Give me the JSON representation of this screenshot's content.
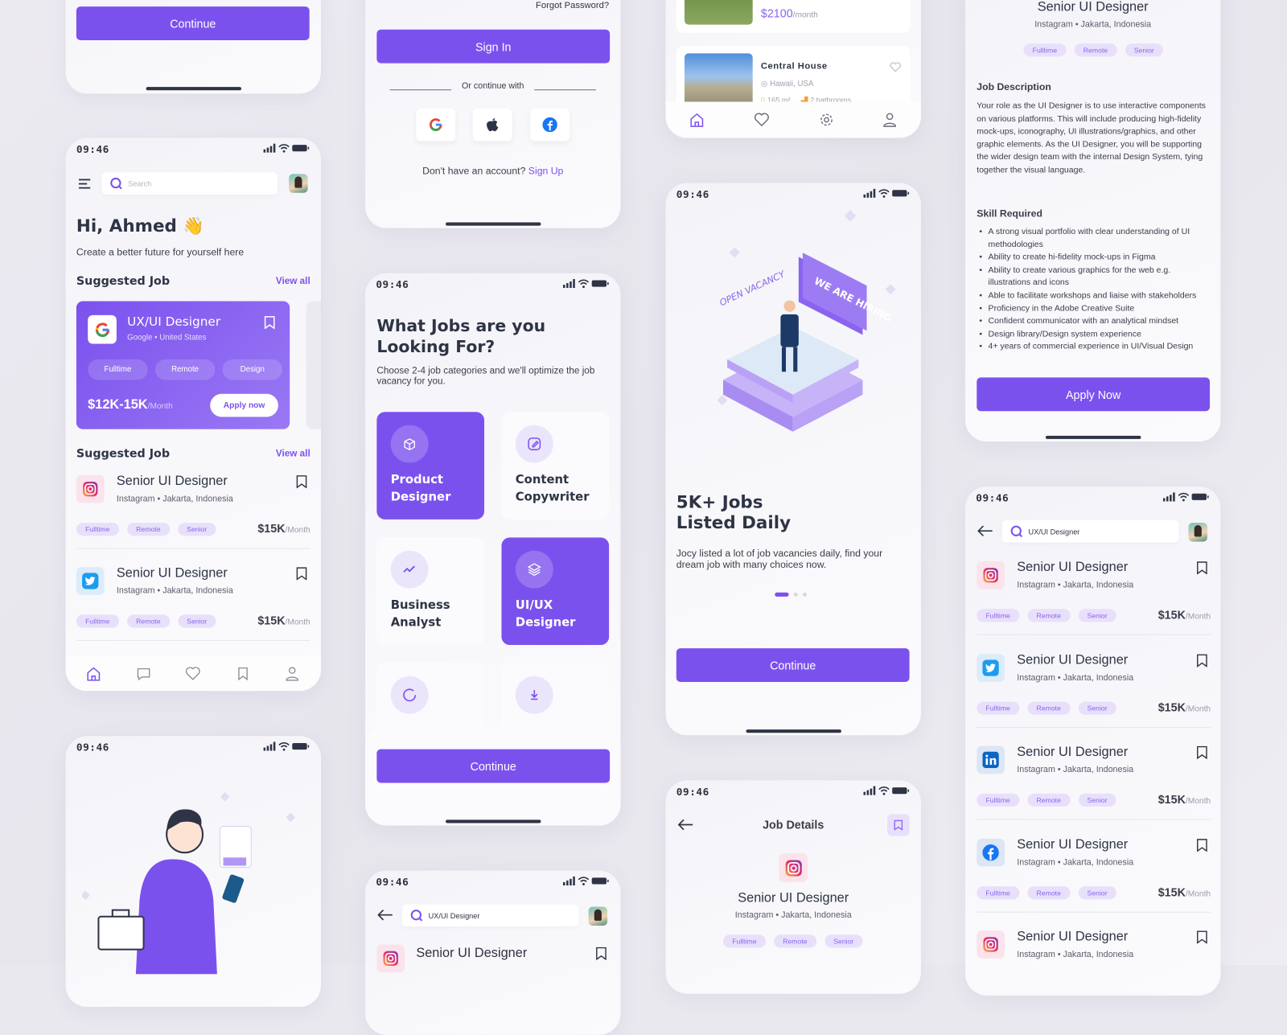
{
  "status": {
    "time": "09:46"
  },
  "onboard_top": {
    "continue_label": "Continue"
  },
  "home": {
    "search_placeholder": "Search",
    "greeting": "Hi, Ahmed",
    "greeting_emoji": "👋",
    "subtitle": "Create a better future for yourself here",
    "section1_title": "Suggested Job",
    "section2_title": "Suggested Job",
    "view_all": "View all",
    "featured": {
      "title": "UX/UI Designer",
      "company": "Google • United States",
      "tags": [
        "Fulltime",
        "Remote",
        "Design"
      ],
      "salary": "$12K-15K",
      "salary_unit": "/Month",
      "apply_label": "Apply now"
    },
    "jobs": [
      {
        "logo": "instagram",
        "title": "Senior UI Designer",
        "company": "Instagram • Jakarta, Indonesia",
        "tags": [
          "Fulltime",
          "Remote",
          "Senior"
        ],
        "salary": "$15K",
        "unit": "/Month"
      },
      {
        "logo": "twitter",
        "title": "Senior UI Designer",
        "company": "Instagram • Jakarta, Indonesia",
        "tags": [
          "Fulltime",
          "Remote",
          "Senior"
        ],
        "salary": "$15K",
        "unit": "/Month"
      }
    ],
    "nav": [
      "home-icon",
      "chat-icon",
      "heart-icon",
      "bookmark-icon",
      "user-icon"
    ]
  },
  "signin": {
    "forgot": "Forgot Password?",
    "signin_label": "Sign In",
    "or_continue": "Or continue with",
    "no_account": "Don't have an account?",
    "signup": "Sign Up"
  },
  "categories": {
    "title": "What Jobs are you Looking For?",
    "subtitle": "Choose 2-4 job categories and we'll optimize the job vacancy for you.",
    "items": [
      {
        "label": "Product Designer",
        "selected": true,
        "icon": "box-pen-icon"
      },
      {
        "label": "Content Copywriter",
        "selected": false,
        "icon": "edit-icon"
      },
      {
        "label": "Business Analyst",
        "selected": false,
        "icon": "trend-icon"
      },
      {
        "label": "UI/UX Designer",
        "selected": true,
        "icon": "layers-icon"
      },
      {
        "label": "",
        "selected": false,
        "icon": "loader-icon"
      },
      {
        "label": "",
        "selected": false,
        "icon": "download-icon"
      }
    ],
    "continue_label": "Continue"
  },
  "search_screen": {
    "query": "UX/UI Designer",
    "first_title": "Senior UI Designer"
  },
  "houses": {
    "price": "$2100",
    "price_unit": "/month",
    "name": "Central House",
    "location": "Hawaii, USA",
    "area": "165 m²",
    "baths": "2 bathrooms"
  },
  "onboarding": {
    "title": "5K+ Jobs Listed Daily",
    "title_line1": "5K+ Jobs",
    "title_line2": "Listed Daily",
    "desc": "Jocy listed a lot of job vacancies daily, find your dream job with many choices now.",
    "page": 1,
    "pages": 3,
    "sign_text1": "OPEN VACANCY",
    "sign_text2": "WE ARE HIRING",
    "continue_label": "Continue"
  },
  "job_details": {
    "header": "Job Details",
    "title": "Senior UI Designer",
    "company": "Instagram • Jakarta, Indonesia",
    "tags": [
      "Fulltime",
      "Remote",
      "Senior"
    ],
    "desc_heading": "Job Description",
    "desc": "Your role as the UI Designer is to use interactive components on various platforms. This will include producing high-fidelity mock-ups, iconography, UI illustrations/graphics, and other graphic elements. As the UI Designer, you will be supporting the wider design team with the internal Design System, tying together the visual language.",
    "skills_heading": "Skill Required",
    "skills": [
      "A strong visual portfolio with clear understanding of UI methodologies",
      "Ability to create hi-fidelity mock-ups in Figma",
      "Ability to create various graphics for the web e.g. illustrations and icons",
      "Able to facilitate workshops and liaise with stakeholders",
      "Proficiency in the Adobe Creative Suite",
      "Confident communicator with an analytical mindset",
      "Design library/Design system experience",
      "4+ years of commercial experience in UI/Visual Design"
    ],
    "apply_label": "Apply Now"
  },
  "results": {
    "query": "UX/UI Designer",
    "jobs": [
      {
        "logo": "instagram",
        "title": "Senior UI Designer",
        "company": "Instagram • Jakarta, Indonesia",
        "tags": [
          "Fulltime",
          "Remote",
          "Senior"
        ],
        "salary": "$15K",
        "unit": "/Month"
      },
      {
        "logo": "twitter",
        "title": "Senior UI Designer",
        "company": "Instagram • Jakarta, Indonesia",
        "tags": [
          "Fulltime",
          "Remote",
          "Senior"
        ],
        "salary": "$15K",
        "unit": "/Month"
      },
      {
        "logo": "linkedin",
        "title": "Senior UI Designer",
        "company": "Instagram • Jakarta, Indonesia",
        "tags": [
          "Fulltime",
          "Remote",
          "Senior"
        ],
        "salary": "$15K",
        "unit": "/Month"
      },
      {
        "logo": "facebook",
        "title": "Senior UI Designer",
        "company": "Instagram • Jakarta, Indonesia",
        "tags": [
          "Fulltime",
          "Remote",
          "Senior"
        ],
        "salary": "$15K",
        "unit": "/Month"
      },
      {
        "logo": "instagram",
        "title": "Senior UI Designer",
        "company": "Instagram • Jakarta, Indonesia",
        "tags": [],
        "salary": "",
        "unit": ""
      }
    ]
  },
  "colors": {
    "accent": "#7b51ee",
    "tag_bg": "#e8e0fb",
    "text": "#2e3445"
  }
}
